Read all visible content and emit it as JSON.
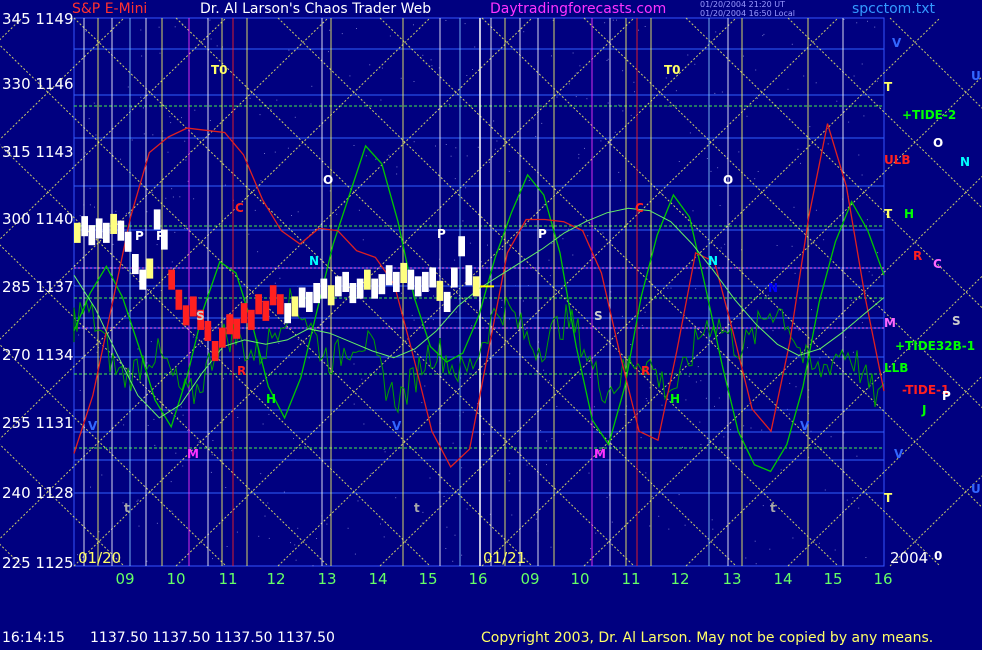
{
  "header": {
    "symbol": "S&P E-Mini",
    "source": "Dr. Al Larson's Chaos Trader Web",
    "site": "Daytradingforecasts.com",
    "stamp1": "01/20/2004 21:20 UT",
    "stamp2": "01/20/2004 16:50 Local",
    "file": "spcctom.txt"
  },
  "footer": {
    "time": "16:14:15",
    "quotes": "1137.50 1137.50 1137.50 1137.50",
    "copyright": "Copyright 2003, Dr. Al Larson. May not be copied by any means."
  },
  "colors": {
    "background": "#000080",
    "price_bar": "#ffffff",
    "price_down": "#ff2020",
    "price_up": "#ffff80",
    "green_cycle": "#00c800",
    "red_cycle": "#e02020",
    "yellow_grid": "#ffff66",
    "x_labels": "#66ff66"
  },
  "chart_data": {
    "type": "line",
    "y_left_labels": [
      "345",
      "330",
      "315",
      "300",
      "285",
      "270",
      "255",
      "240",
      "225"
    ],
    "y_prices": [
      1149,
      1146,
      1143,
      1140,
      1137,
      1134,
      1131,
      1128,
      1125
    ],
    "ylim": [
      1125,
      1149
    ],
    "x_tick_labels": [
      "09",
      "10",
      "11",
      "12",
      "13",
      "14",
      "15",
      "16",
      "09",
      "10",
      "11",
      "12",
      "13",
      "14",
      "15",
      "16"
    ],
    "session_labels": [
      "01/20",
      "01/21",
      "2004"
    ],
    "price_series": {
      "name": "",
      "values": [
        1139.9,
        1140.2,
        1139.8,
        1140.1,
        1139.9,
        1140.3,
        1140.0,
        1139.5,
        1138.5,
        1137.8,
        1138.3,
        1140.5,
        1139.6,
        1137.8,
        1136.9,
        1136.2,
        1136.6,
        1136.0,
        1135.5,
        1134.6,
        1135.2,
        1135.8,
        1135.6,
        1136.3,
        1136.0,
        1136.7,
        1136.4,
        1137.1,
        1136.7,
        1136.3,
        1136.6,
        1137.0,
        1136.8,
        1137.2,
        1137.4,
        1137.1,
        1137.5,
        1137.7,
        1137.2,
        1137.4,
        1137.8,
        1137.4,
        1137.6,
        1138.0,
        1137.7,
        1138.1,
        1137.8,
        1137.5,
        1137.7,
        1137.9,
        1137.3,
        1136.8,
        1137.9,
        1139.3,
        1138.0,
        1137.5
      ]
    },
    "green_cycle": [
      1135.5,
      1137.2,
      1138.4,
      1137.0,
      1134.8,
      1132.4,
      1131.2,
      1133.5,
      1136.5,
      1138.6,
      1138.1,
      1135.8,
      1133.0,
      1131.6,
      1133.4,
      1136.4,
      1139.4,
      1141.6,
      1143.8,
      1143.0,
      1140.4,
      1137.0,
      1134.8,
      1134.1,
      1134.5,
      1136.2,
      1138.8,
      1140.8,
      1142.5,
      1141.6,
      1139.0,
      1134.8,
      1131.5,
      1130.4,
      1133.0,
      1137.0,
      1139.8,
      1141.6,
      1140.6,
      1137.4,
      1134.0,
      1131.0,
      1129.5,
      1129.2,
      1130.4,
      1133.0,
      1136.8,
      1139.5,
      1141.3,
      1140.0,
      1138.0
    ],
    "red_cycle": [
      1130.0,
      1132.6,
      1136.6,
      1140.6,
      1143.5,
      1144.2,
      1144.6,
      1144.5,
      1144.4,
      1143.4,
      1141.4,
      1140.0,
      1139.4,
      1140.1,
      1140.0,
      1139.1,
      1138.8,
      1137.6,
      1134.4,
      1131.0,
      1129.4,
      1130.2,
      1134.6,
      1139.0,
      1140.5,
      1140.5,
      1140.4,
      1140.0,
      1138.1,
      1134.4,
      1131.0,
      1130.6,
      1134.6,
      1139.0,
      1138.6,
      1135.4,
      1132.0,
      1131.0,
      1135.0,
      1140.6,
      1144.8,
      1142.0,
      1137.0,
      1132.8
    ],
    "second_green_cycle": [
      1138.0,
      1136.5,
      1134.5,
      1132.6,
      1131.6,
      1132.2,
      1133.6,
      1134.8,
      1135.1,
      1134.9,
      1135.1,
      1135.6,
      1135.4,
      1135.0,
      1134.6,
      1134.3,
      1134.7,
      1135.5,
      1136.6,
      1137.4,
      1138.0,
      1138.6,
      1139.2,
      1139.9,
      1140.4,
      1140.8,
      1141.0,
      1140.9,
      1140.4,
      1139.4,
      1138.2,
      1136.9,
      1135.8,
      1134.9,
      1134.4,
      1134.7,
      1135.4,
      1136.2,
      1137.0
    ],
    "cycle_labels": [
      "T0",
      "T0",
      "O",
      "O",
      "C",
      "C",
      "P",
      "P",
      "P",
      "P",
      "N",
      "N",
      "N",
      "S",
      "S",
      "R",
      "R",
      "H",
      "H",
      "V",
      "V",
      "V",
      "M",
      "M",
      "t",
      "t",
      "t",
      "U",
      "U"
    ],
    "right_labels": [
      "V",
      "T",
      "+TIDE-2",
      "O",
      "N",
      "ULB",
      "T",
      "H",
      "R",
      "C",
      "M",
      "S",
      "+TIDE32B-1",
      "LLB",
      "-TIDE-1",
      "P",
      "J",
      "V",
      "T",
      "0"
    ]
  }
}
